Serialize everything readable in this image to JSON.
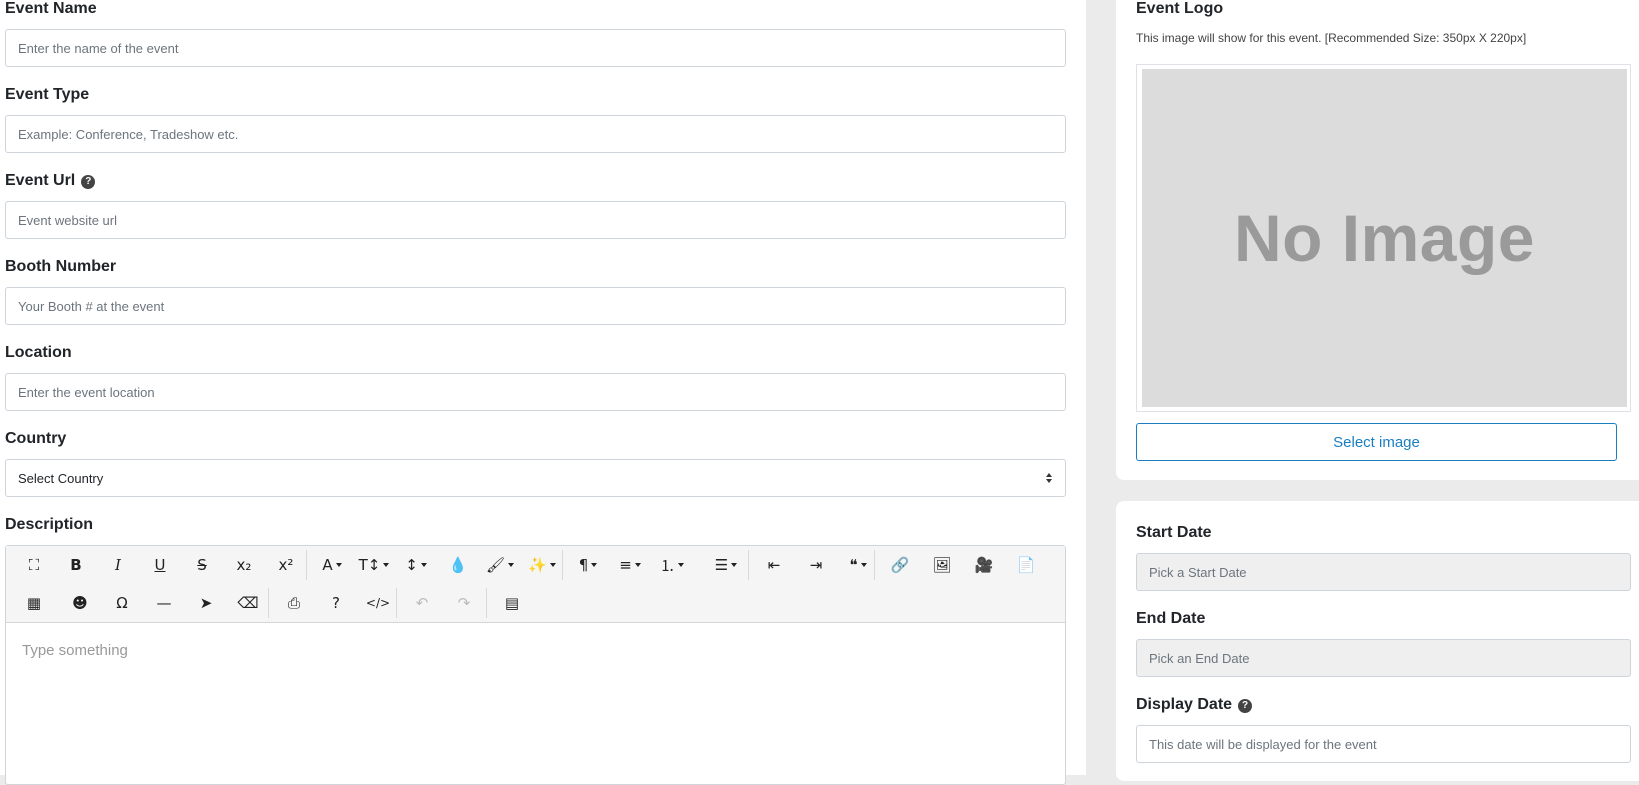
{
  "form": {
    "event_name": {
      "label": "Event Name",
      "placeholder": "Enter the name of the event"
    },
    "event_type": {
      "label": "Event Type",
      "placeholder": "Example: Conference, Tradeshow etc."
    },
    "event_url": {
      "label": "Event Url",
      "placeholder": "Event website url",
      "help_glyph": "?"
    },
    "booth_number": {
      "label": "Booth Number",
      "placeholder": "Your Booth # at the event"
    },
    "location": {
      "label": "Location",
      "placeholder": "Enter the event location"
    },
    "country": {
      "label": "Country",
      "selected": "Select Country"
    },
    "description": {
      "label": "Description",
      "placeholder": "Type something"
    }
  },
  "toolbar": {
    "row1": [
      {
        "name": "fullscreen-icon",
        "glyph": "⛶"
      },
      {
        "name": "bold-icon",
        "glyph": "B"
      },
      {
        "name": "italic-icon",
        "glyph": "I"
      },
      {
        "name": "underline-icon",
        "glyph": "U"
      },
      {
        "name": "strikethrough-icon",
        "glyph": "S"
      },
      {
        "name": "subscript-icon",
        "glyph": "x₂"
      },
      {
        "name": "superscript-icon",
        "glyph": "x²"
      },
      {
        "name": "font-family-icon",
        "glyph": "A",
        "caret": true
      },
      {
        "name": "font-size-icon",
        "glyph": "T↕",
        "caret": true
      },
      {
        "name": "line-height-icon",
        "glyph": "↕",
        "caret": true
      },
      {
        "name": "color-icon",
        "glyph": "💧"
      },
      {
        "name": "brush-icon",
        "glyph": "🖌",
        "caret": true
      },
      {
        "name": "magic-wand-icon",
        "glyph": "✨",
        "caret": true
      },
      {
        "name": "paragraph-icon",
        "glyph": "¶",
        "caret": true
      },
      {
        "name": "align-icon",
        "glyph": "≡",
        "caret": true
      },
      {
        "name": "ordered-list-icon",
        "glyph": "⒈",
        "caret": true
      },
      {
        "name": "unordered-list-icon",
        "glyph": "☰",
        "caret": true
      },
      {
        "name": "outdent-icon",
        "glyph": "⇤"
      },
      {
        "name": "indent-icon",
        "glyph": "⇥"
      },
      {
        "name": "quote-icon",
        "glyph": "❝",
        "caret": true
      },
      {
        "name": "link-icon",
        "glyph": "🔗"
      },
      {
        "name": "image-icon",
        "glyph": "🖼"
      },
      {
        "name": "video-icon",
        "glyph": "🎥"
      },
      {
        "name": "file-icon",
        "glyph": "📄"
      }
    ],
    "row2": [
      {
        "name": "table-icon",
        "glyph": "▦"
      },
      {
        "name": "emoticon-icon",
        "glyph": "☻"
      },
      {
        "name": "special-char-icon",
        "glyph": "Ω"
      },
      {
        "name": "horizontal-line-icon",
        "glyph": "—"
      },
      {
        "name": "select-all-icon",
        "glyph": "➤"
      },
      {
        "name": "clear-format-icon",
        "glyph": "⌫"
      },
      {
        "name": "print-icon",
        "glyph": "⎙"
      },
      {
        "name": "help-icon",
        "glyph": "?"
      },
      {
        "name": "code-view-icon",
        "glyph": "</>"
      },
      {
        "name": "undo-icon",
        "glyph": "↶",
        "disabled": true
      },
      {
        "name": "redo-icon",
        "glyph": "↷",
        "disabled": true
      },
      {
        "name": "html-view-icon",
        "glyph": "▤"
      }
    ]
  },
  "logo_panel": {
    "title": "Event Logo",
    "description": "This image will show for this event. [Recommended Size: 350px X 220px]",
    "placeholder_text": "No Image",
    "select_button": "Select image"
  },
  "dates_panel": {
    "start_date": {
      "label": "Start Date",
      "placeholder": "Pick a Start Date"
    },
    "end_date": {
      "label": "End Date",
      "placeholder": "Pick an End Date"
    },
    "display_date": {
      "label": "Display Date",
      "placeholder": "This date will be displayed for the event",
      "help_glyph": "?"
    }
  }
}
